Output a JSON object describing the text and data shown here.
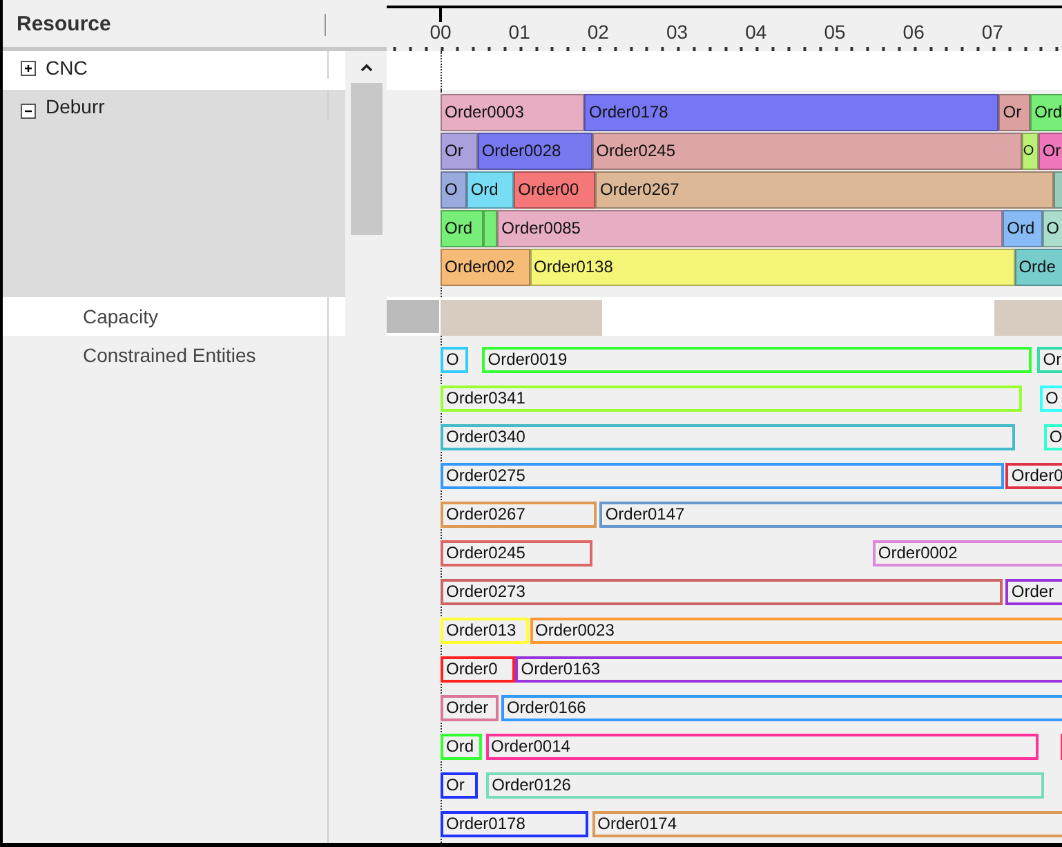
{
  "header": {
    "column": "Resource"
  },
  "timeline": {
    "ticks": [
      "00",
      "01",
      "02",
      "03",
      "04",
      "05",
      "06",
      "07"
    ]
  },
  "resources": [
    {
      "name": "CNC",
      "expanded": false
    },
    {
      "name": "Deburr",
      "expanded": true,
      "lanes": [
        {
          "bars": [
            {
              "label": "Order0003",
              "color": "#e6adc3"
            },
            {
              "label": "Order0178",
              "color": "#7777f5"
            },
            {
              "label": "Or",
              "color": "#dda0a0"
            },
            {
              "label": "Ord",
              "color": "#77ee77"
            }
          ]
        },
        {
          "bars": [
            {
              "label": "Or",
              "color": "#aaa0dd"
            },
            {
              "label": "Order0028",
              "color": "#7777f0"
            },
            {
              "label": "Order0245",
              "color": "#dda5a5"
            },
            {
              "label": "O",
              "color": "#bbf077"
            },
            {
              "label": "Or",
              "color": "#f077bb"
            }
          ]
        },
        {
          "bars": [
            {
              "label": "O",
              "color": "#99aadd"
            },
            {
              "label": "Ord",
              "color": "#77ddf5"
            },
            {
              "label": "Order00",
              "color": "#f57777"
            },
            {
              "label": "Order0267",
              "color": "#dcb896"
            },
            {
              "color": "#99ccbb"
            }
          ]
        },
        {
          "bars": [
            {
              "label": "Ord",
              "color": "#77ee77"
            },
            {
              "color": "#77ee77"
            },
            {
              "label": "Order0085",
              "color": "#e6adc3"
            },
            {
              "label": "Ord",
              "color": "#88bbf5"
            },
            {
              "label": "O",
              "color": "#aaddcc"
            }
          ]
        },
        {
          "bars": [
            {
              "label": "Order002",
              "color": "#f5bb77"
            },
            {
              "label": "Order0138",
              "color": "#f5f577"
            },
            {
              "label": "Orde",
              "color": "#77cccc"
            }
          ]
        }
      ],
      "children": [
        {
          "name": "Capacity",
          "kind": "capacity",
          "segments": [
            {
              "color": "#d8ccc0"
            },
            {
              "color": "#d8ccc0"
            }
          ]
        },
        {
          "name": "Constrained Entities",
          "kind": "entities",
          "rows": [
            {
              "bars": [
                {
                  "label": "O",
                  "color": "#33ccff"
                },
                {
                  "label": "Order0019",
                  "color": "#33ff33"
                },
                {
                  "label": "Or",
                  "color": "#33ddaa"
                }
              ]
            },
            {
              "bars": [
                {
                  "label": "Order0341",
                  "color": "#99ff33"
                },
                {
                  "label": "O",
                  "color": "#33ffff"
                }
              ]
            },
            {
              "bars": [
                {
                  "label": "Order0340",
                  "color": "#44bbcc"
                },
                {
                  "label": "O",
                  "color": "#33ffcc"
                }
              ]
            },
            {
              "bars": [
                {
                  "label": "Order0275",
                  "color": "#3399ff"
                },
                {
                  "label": "Order0",
                  "color": "#dd3344"
                }
              ]
            },
            {
              "bars": [
                {
                  "label": "Order0267",
                  "color": "#dd9955"
                },
                {
                  "label": "Order0147",
                  "color": "#6699cc"
                }
              ]
            },
            {
              "bars": [
                {
                  "label": "Order0245",
                  "color": "#dd6666"
                },
                {
                  "label": "Order0002",
                  "color": "#dd88dd"
                }
              ]
            },
            {
              "bars": [
                {
                  "label": "Order0273",
                  "color": "#cc6666"
                },
                {
                  "label": "Order",
                  "color": "#9933dd"
                }
              ]
            },
            {
              "bars": [
                {
                  "label": "Order013",
                  "color": "#ffff33"
                },
                {
                  "label": "Order0023",
                  "color": "#ff9933"
                }
              ]
            },
            {
              "bars": [
                {
                  "label": "Order0",
                  "color": "#ff2222"
                },
                {
                  "label": "Order0163",
                  "color": "#9933dd"
                }
              ]
            },
            {
              "bars": [
                {
                  "label": "Order",
                  "color": "#dd7799"
                },
                {
                  "label": "Order0166",
                  "color": "#3399ff"
                }
              ]
            },
            {
              "bars": [
                {
                  "label": "Ord",
                  "color": "#33ff33"
                },
                {
                  "label": "Order0014",
                  "color": "#ff3399"
                },
                {
                  "color": "#ff3366"
                }
              ]
            },
            {
              "bars": [
                {
                  "label": "Or",
                  "color": "#2233ff"
                },
                {
                  "label": "Order0126",
                  "color": "#77ddbb"
                }
              ]
            },
            {
              "bars": [
                {
                  "label": "Order0178",
                  "color": "#2233ff"
                },
                {
                  "label": "Order0174",
                  "color": "#dd9955"
                }
              ]
            }
          ]
        }
      ]
    }
  ]
}
